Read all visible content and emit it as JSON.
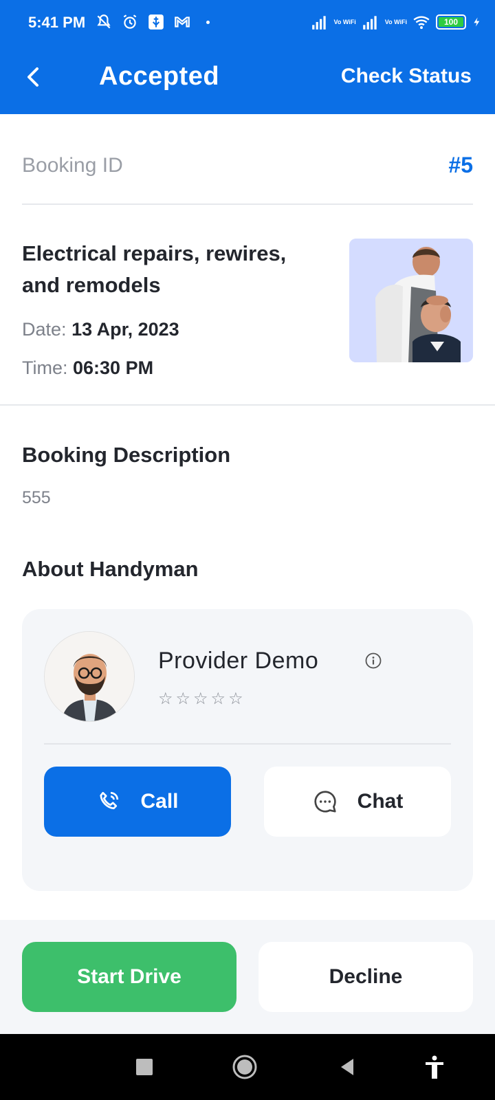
{
  "status_bar": {
    "time": "5:41 PM",
    "battery": "100",
    "vowifi": "Vo WiFi",
    "icons_left": [
      "mute-icon",
      "alarm-icon",
      "usb-icon",
      "gmail-icon"
    ],
    "icons_right": [
      "signal-icon",
      "wifi-icon",
      "battery-icon",
      "charging-icon"
    ]
  },
  "appbar": {
    "title": "Accepted",
    "action": "Check Status"
  },
  "booking": {
    "id_label": "Booking ID",
    "id_value": "#5",
    "service_name": "Electrical repairs, rewires, and remodels",
    "date_label": "Date:",
    "date_value": "13 Apr, 2023",
    "time_label": "Time:",
    "time_value": "06:30 PM"
  },
  "description": {
    "heading": "Booking Description",
    "text": "555"
  },
  "handyman": {
    "heading": "About Handyman",
    "name": "Provider Demo",
    "rating_stars": 0,
    "call_label": "Call",
    "chat_label": "Chat"
  },
  "actions": {
    "start_label": "Start Drive",
    "decline_label": "Decline"
  },
  "colors": {
    "primary": "#0b6fe6",
    "success": "#3dbf6b",
    "card_bg": "#f4f6f9"
  }
}
